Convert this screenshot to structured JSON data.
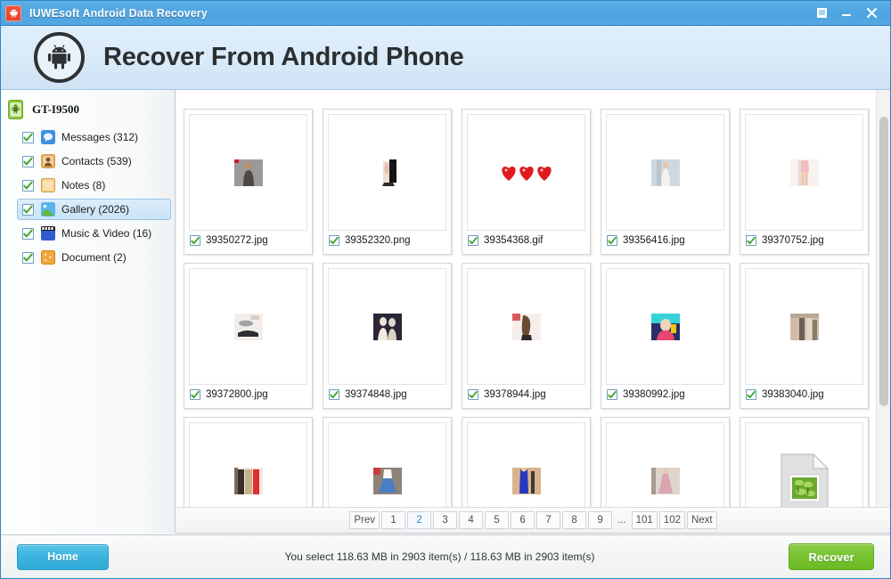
{
  "window": {
    "title": "IUWEsoft Android Data Recovery",
    "app_icon": "android-icon",
    "controls": {
      "restore_label": "restore-icon",
      "minimize_label": "minimize-icon",
      "close_label": "close-icon"
    }
  },
  "banner": {
    "icon": "android-robot-icon",
    "title": "Recover From Android Phone"
  },
  "sidebar": {
    "device": {
      "icon": "phone-icon",
      "name": "GT-I9500"
    },
    "items": [
      {
        "label": "Messages (312)",
        "icon": "messages-icon",
        "color": "#3d8fe0",
        "checked": true,
        "selected": false
      },
      {
        "label": "Contacts (539)",
        "icon": "contacts-icon",
        "color": "#e3a24e",
        "checked": true,
        "selected": false
      },
      {
        "label": "Notes (8)",
        "icon": "notes-icon",
        "color": "#f0b964",
        "checked": true,
        "selected": false
      },
      {
        "label": "Gallery (2026)",
        "icon": "gallery-icon",
        "color": "#5bb4e8",
        "checked": true,
        "selected": true
      },
      {
        "label": "Music & Video (16)",
        "icon": "music-video-icon",
        "color": "#2f5bd0",
        "checked": true,
        "selected": false
      },
      {
        "label": "Document (2)",
        "icon": "document-icon",
        "color": "#f0a93c",
        "checked": true,
        "selected": false
      }
    ]
  },
  "gallery": {
    "files": [
      {
        "name": "39350272.jpg",
        "checked": true,
        "thumb": "man-grey-shirt-photo"
      },
      {
        "name": "39352320.png",
        "checked": true,
        "thumb": "dress-dark-photo"
      },
      {
        "name": "39354368.gif",
        "checked": true,
        "thumb": "red-hearts-animation"
      },
      {
        "name": "39356416.jpg",
        "checked": true,
        "thumb": "white-dress-photo"
      },
      {
        "name": "39370752.jpg",
        "checked": true,
        "thumb": "pink-outfit-photo"
      },
      {
        "name": "39372800.jpg",
        "checked": true,
        "thumb": "shoes-photo"
      },
      {
        "name": "39374848.jpg",
        "checked": true,
        "thumb": "night-portrait-photo"
      },
      {
        "name": "39378944.jpg",
        "checked": true,
        "thumb": "girl-back-photo"
      },
      {
        "name": "39380992.jpg",
        "checked": true,
        "thumb": "colorful-portrait-photo"
      },
      {
        "name": "39383040.jpg",
        "checked": true,
        "thumb": "street-people-photo"
      },
      {
        "name": "",
        "checked": false,
        "thumb": "red-trousers-photo"
      },
      {
        "name": "",
        "checked": false,
        "thumb": "blue-skirt-photo"
      },
      {
        "name": "",
        "checked": false,
        "thumb": "blue-dress-photo"
      },
      {
        "name": "",
        "checked": false,
        "thumb": "pink-dress-photo"
      },
      {
        "name": "",
        "checked": false,
        "thumb": "generic-image-placeholder-icon"
      }
    ],
    "scrollbar": {
      "name": "vertical-scrollbar"
    }
  },
  "pagination": {
    "prev_label": "Prev",
    "next_label": "Next",
    "ellipsis": "...",
    "pages": [
      "1",
      "2",
      "3",
      "4",
      "5",
      "6",
      "7",
      "8",
      "9"
    ],
    "tail_pages": [
      "101",
      "102"
    ],
    "current": "2"
  },
  "footer": {
    "home_label": "Home",
    "status_text": "You select 118.63 MB in 2903 item(s) / 118.63 MB in 2903 item(s)",
    "recover_label": "Recover"
  },
  "colors": {
    "titlebar": "#4ea4e0",
    "banner": "#d8e9f8",
    "accent_blue": "#3ab4df",
    "accent_green": "#76c22f",
    "check_green": "#4aa832",
    "selection": "#c9e3f8"
  }
}
